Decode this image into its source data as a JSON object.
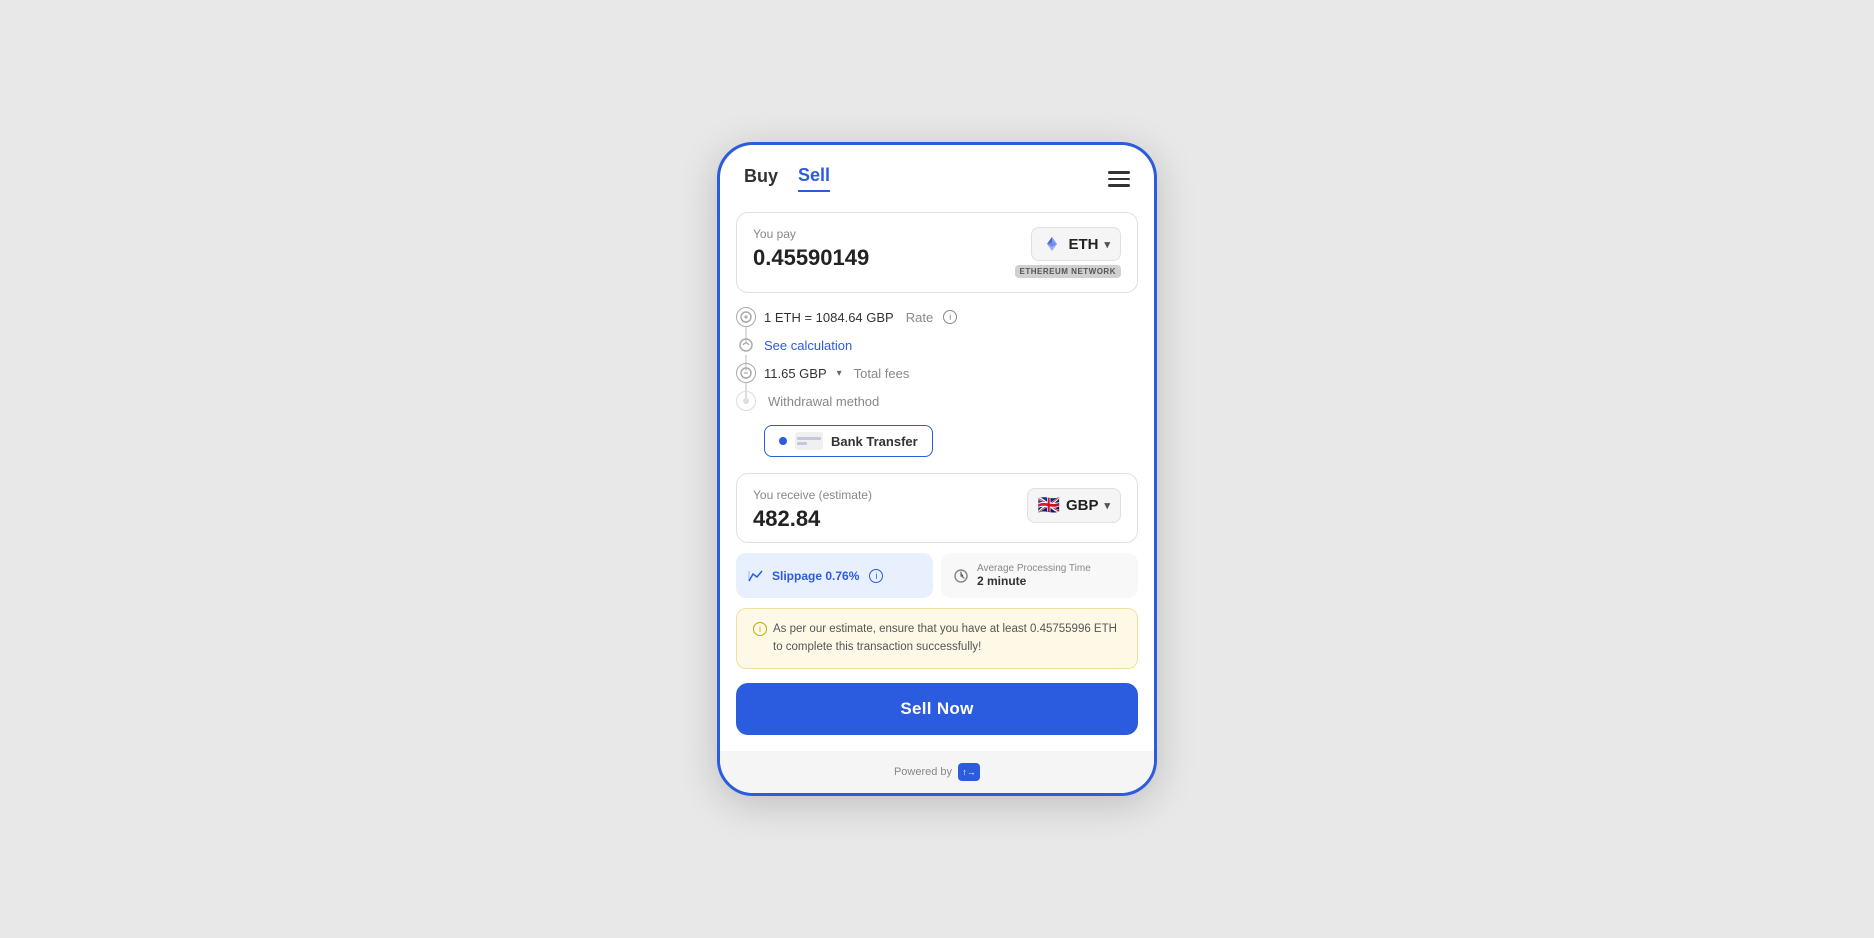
{
  "tabs": {
    "buy": "Buy",
    "sell": "Sell"
  },
  "pay_section": {
    "label": "You pay",
    "value": "0.45590149",
    "currency": "ETH",
    "network": "ETHEREUM NETWORK"
  },
  "rate": {
    "text": "1 ETH = 1084.64 GBP",
    "rate_label": "Rate"
  },
  "calculation": {
    "text": "See calculation"
  },
  "fees": {
    "value": "11.65 GBP",
    "label": "Total fees"
  },
  "withdrawal": {
    "label": "Withdrawal method",
    "method": "Bank Transfer"
  },
  "receive_section": {
    "label": "You receive (estimate)",
    "value": "482.84",
    "currency": "GBP"
  },
  "slippage": {
    "text": "Slippage 0.76%"
  },
  "processing": {
    "label": "Average Processing Time",
    "value": "2 minute"
  },
  "warning": {
    "text": "As per our estimate, ensure that you have at least 0.45755996 ETH to complete this transaction successfully!"
  },
  "sell_button": "Sell Now",
  "footer": {
    "powered_by": "Powered by"
  }
}
